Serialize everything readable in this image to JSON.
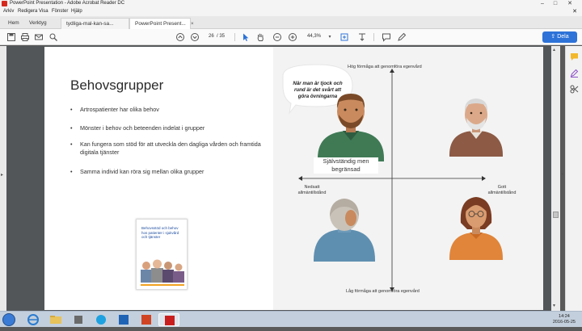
{
  "titlebar": {
    "title": "PowerPoint Presentation - Adobe Acrobat Reader DC",
    "min": "–",
    "max": "□",
    "close": "✕"
  },
  "menubar": {
    "items": [
      "Arkiv",
      "Redigera",
      "Visa",
      "Fönster",
      "Hjälp"
    ],
    "close": "✕"
  },
  "tabs": {
    "home": "Hem",
    "tools": "Verktyg",
    "doc1": "tydliga-mal-kan-sa...",
    "doc2": "PowerPoint Present...",
    "close": "×"
  },
  "toolbar": {
    "page_current": "26",
    "page_total": "/ 35",
    "zoom": "44,3%",
    "share_label": "Dela"
  },
  "slide": {
    "title": "Behovsgrupper",
    "bullets": [
      "Artrospatienter har olika behov",
      "Mönster i behov och beteenden indelat i grupper",
      "Kan fungera som stöd för att utveckla den dagliga vården och framtida digitala tjänster",
      "Samma individ kan röra sig mellan olika grupper"
    ],
    "book_title": "Behovsstöd och behov hos patienter i sjukvård och tjänster",
    "axis_top": "Hög förmåga att genomföra egenvård",
    "axis_bottom": "Låg förmåga att genomföra egenvård",
    "axis_left": "Nedsatt allmäntillstånd",
    "axis_right": "Gott allmäntillstånd",
    "bubble": "När man är tjock och rund är det svårt att göra övningarna",
    "caption": "Självständig men begränsad"
  },
  "taskbar": {
    "time": "14:24",
    "date": "2016-05-25"
  },
  "colors": {
    "accent": "#2d73d8",
    "skin": "#c98a5e",
    "green_shirt": "#3f7a55",
    "brown_shirt": "#8c5a45",
    "blue_shirt": "#5f8fb0",
    "orange_shirt": "#e0853a"
  }
}
